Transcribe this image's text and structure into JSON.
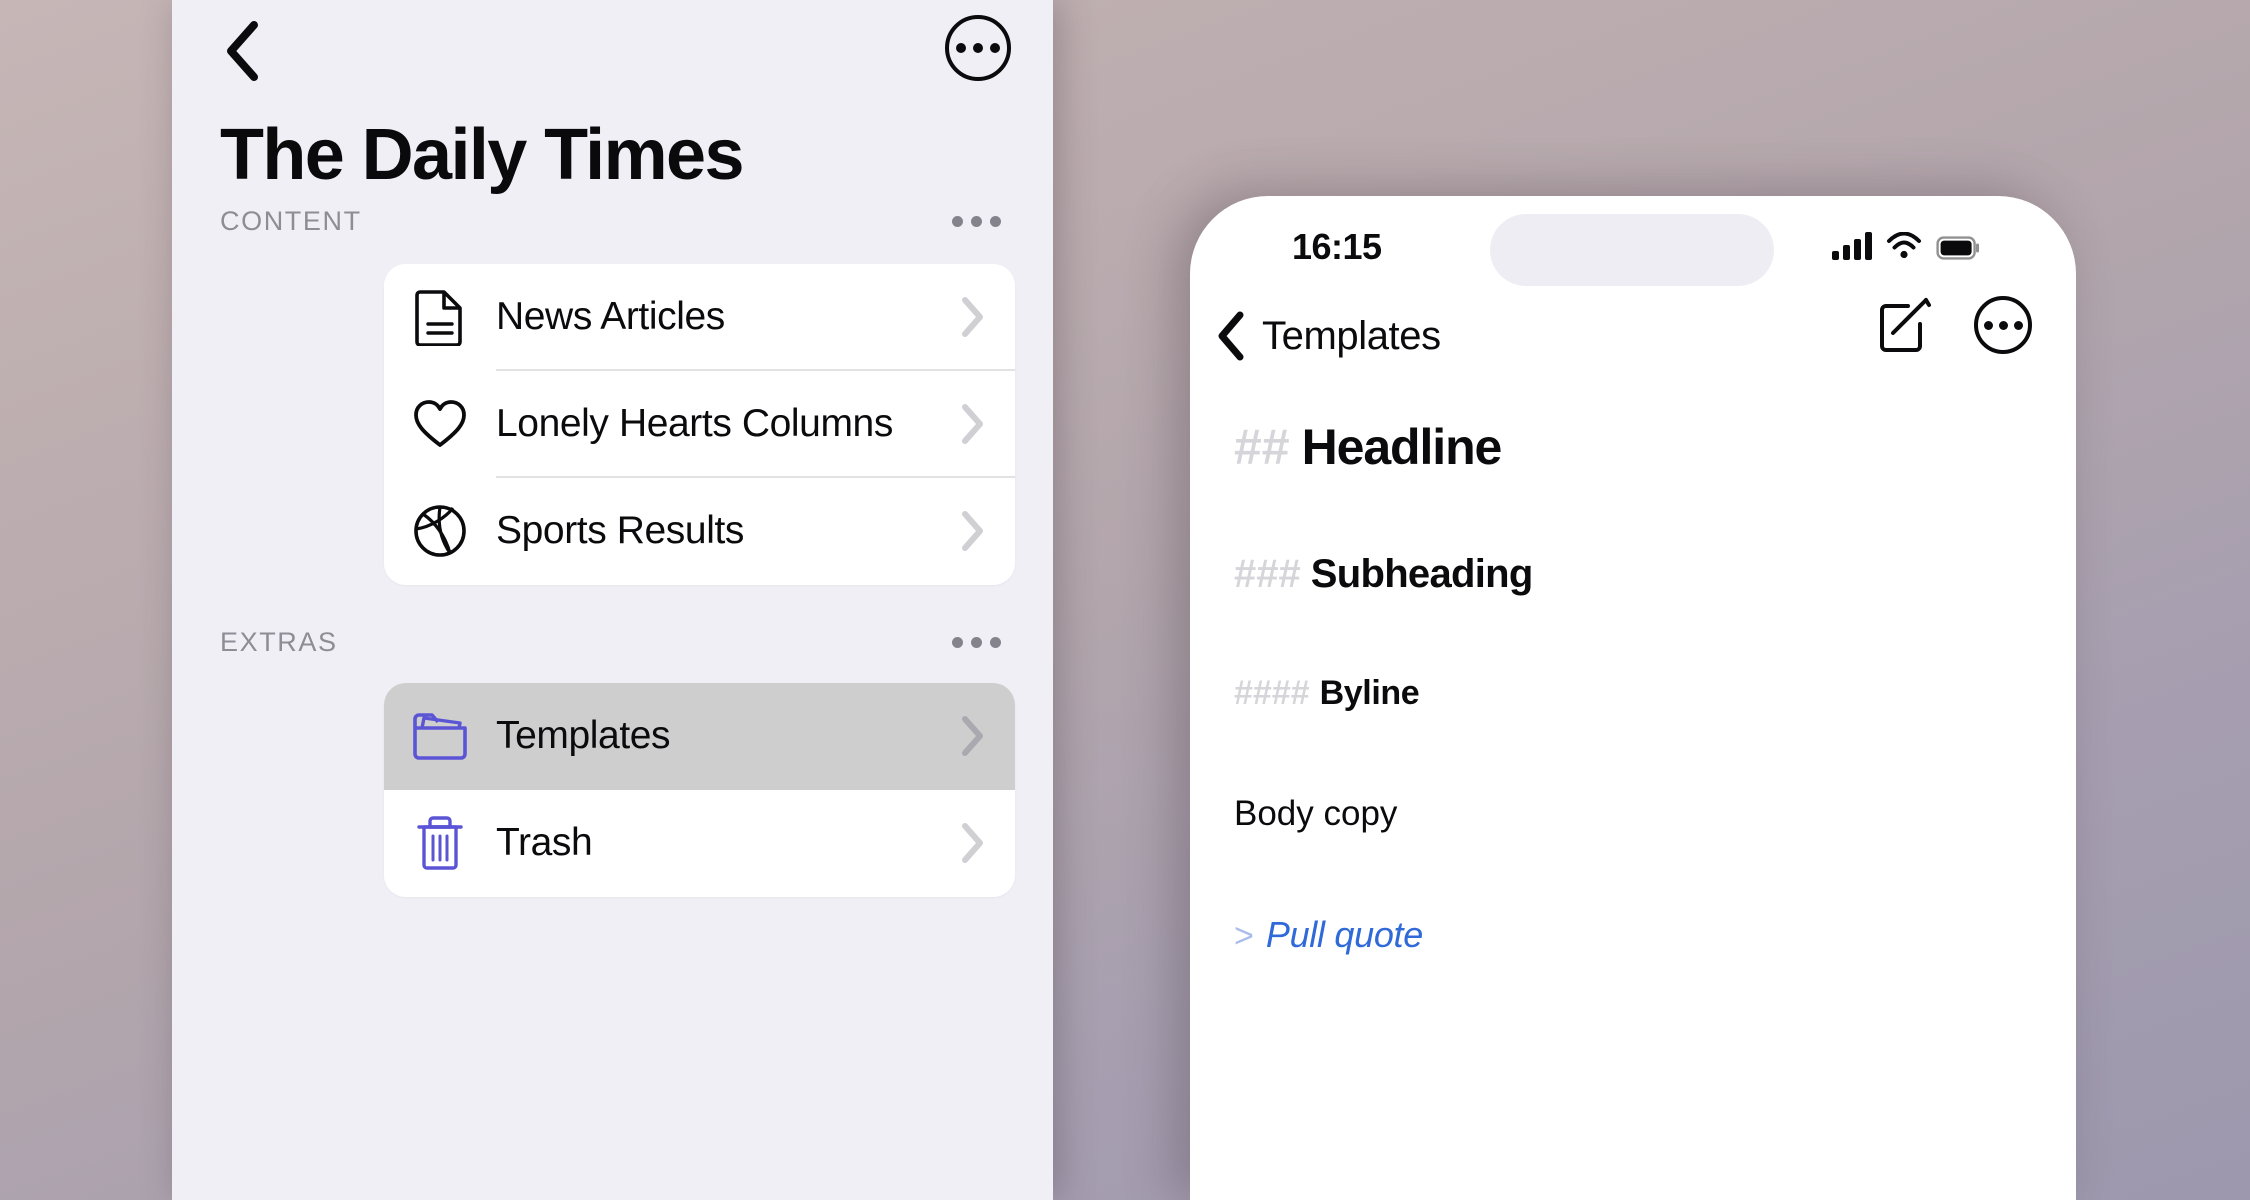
{
  "theme": {
    "accent_purple": "#5b55d6",
    "quote_blue": "#3069d8",
    "sidebar_bg": "#f0eff5",
    "selected_row_bg": "#cececf",
    "muted_text": "#8e8d96"
  },
  "sidebar": {
    "back_icon": "chevron-left-icon",
    "more_icon": "ellipsis-circle-icon",
    "title": "The Daily Times",
    "sections": [
      {
        "header": "CONTENT",
        "more_icon": "ellipsis-icon",
        "items": [
          {
            "label": "News Articles",
            "icon": "document-icon",
            "selected": false
          },
          {
            "label": "Lonely Hearts Columns",
            "icon": "heart-icon",
            "selected": false
          },
          {
            "label": "Sports Results",
            "icon": "basketball-icon",
            "selected": false
          }
        ]
      },
      {
        "header": "EXTRAS",
        "more_icon": "ellipsis-icon",
        "items": [
          {
            "label": "Templates",
            "icon": "folder-icon",
            "selected": true
          },
          {
            "label": "Trash",
            "icon": "trash-icon",
            "selected": false
          }
        ]
      }
    ]
  },
  "phone": {
    "status": {
      "time": "16:15",
      "cellular_icon": "signal-bars-icon",
      "wifi_icon": "wifi-icon",
      "battery_icon": "battery-full-icon"
    },
    "nav": {
      "back_icon": "chevron-left-icon",
      "title": "Templates",
      "compose_icon": "compose-icon",
      "more_icon": "ellipsis-circle-icon"
    },
    "document": {
      "lines": [
        {
          "mark": "##",
          "text": "Headline",
          "style": "h2"
        },
        {
          "mark": "###",
          "text": "Subheading",
          "style": "h3"
        },
        {
          "mark": "####",
          "text": "Byline",
          "style": "h4"
        },
        {
          "mark": "",
          "text": "Body copy",
          "style": "body"
        },
        {
          "mark": ">",
          "text": "Pull quote",
          "style": "quote"
        }
      ]
    }
  }
}
